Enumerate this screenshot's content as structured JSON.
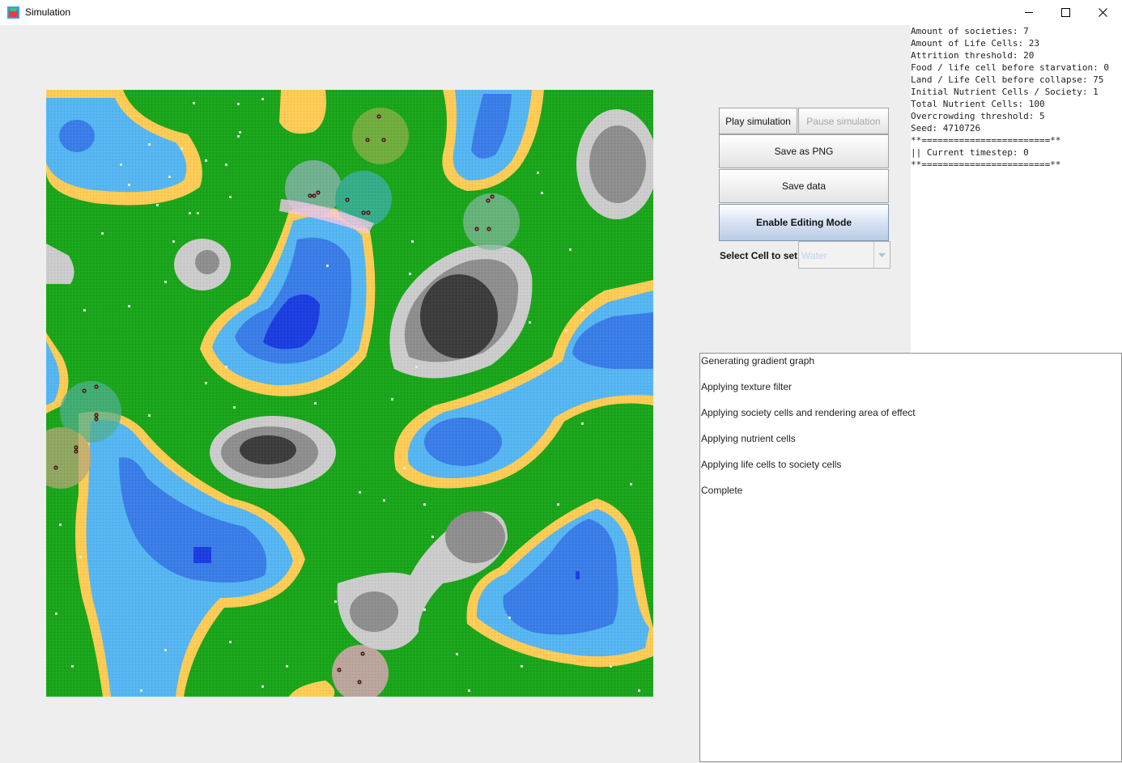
{
  "window": {
    "title": "Simulation",
    "icon": "simulation-app-icon",
    "controls": [
      "minimize-icon",
      "maximize-icon",
      "close-icon"
    ]
  },
  "controls": {
    "play_label": "Play simulation",
    "pause_label": "Pause simulation",
    "save_png_label": "Save as PNG",
    "save_data_label": "Save data",
    "editing_label": "Enable Editing Mode",
    "select_cell_label": "Select Cell to set:",
    "select_cell_value": "Water"
  },
  "info": {
    "lines": [
      "Amount of societies: 7",
      "Amount of Life Cells: 23",
      "Attrition threshold: 20",
      "Food / life cell before starvation: 0",
      "Land / Life Cell before collapse: 75",
      "Initial Nutrient Cells / Society: 1",
      "Total Nutrient Cells: 100",
      "Overcrowding threshold: 5",
      "Seed: 4710726",
      "**========================**",
      "|| Current timestep: 0",
      "**========================**"
    ]
  },
  "log": {
    "lines": [
      "Generating gradient graph",
      "Applying texture filter",
      "Applying society cells and rendering area of effect",
      "Applying nutrient cells",
      "Applying life cells to society cells",
      "Complete"
    ]
  },
  "map": {
    "colors": {
      "grass": "#1aa51a",
      "sand": "#ffcc55",
      "shallow_water": "#55b6f2",
      "water": "#3a7de8",
      "deep_water": "#1c3de0",
      "stone_light": "#cccccc",
      "stone": "#8e8e8e",
      "stone_dark": "#3c3c3c",
      "nutrient": "#d7f2d7"
    }
  }
}
